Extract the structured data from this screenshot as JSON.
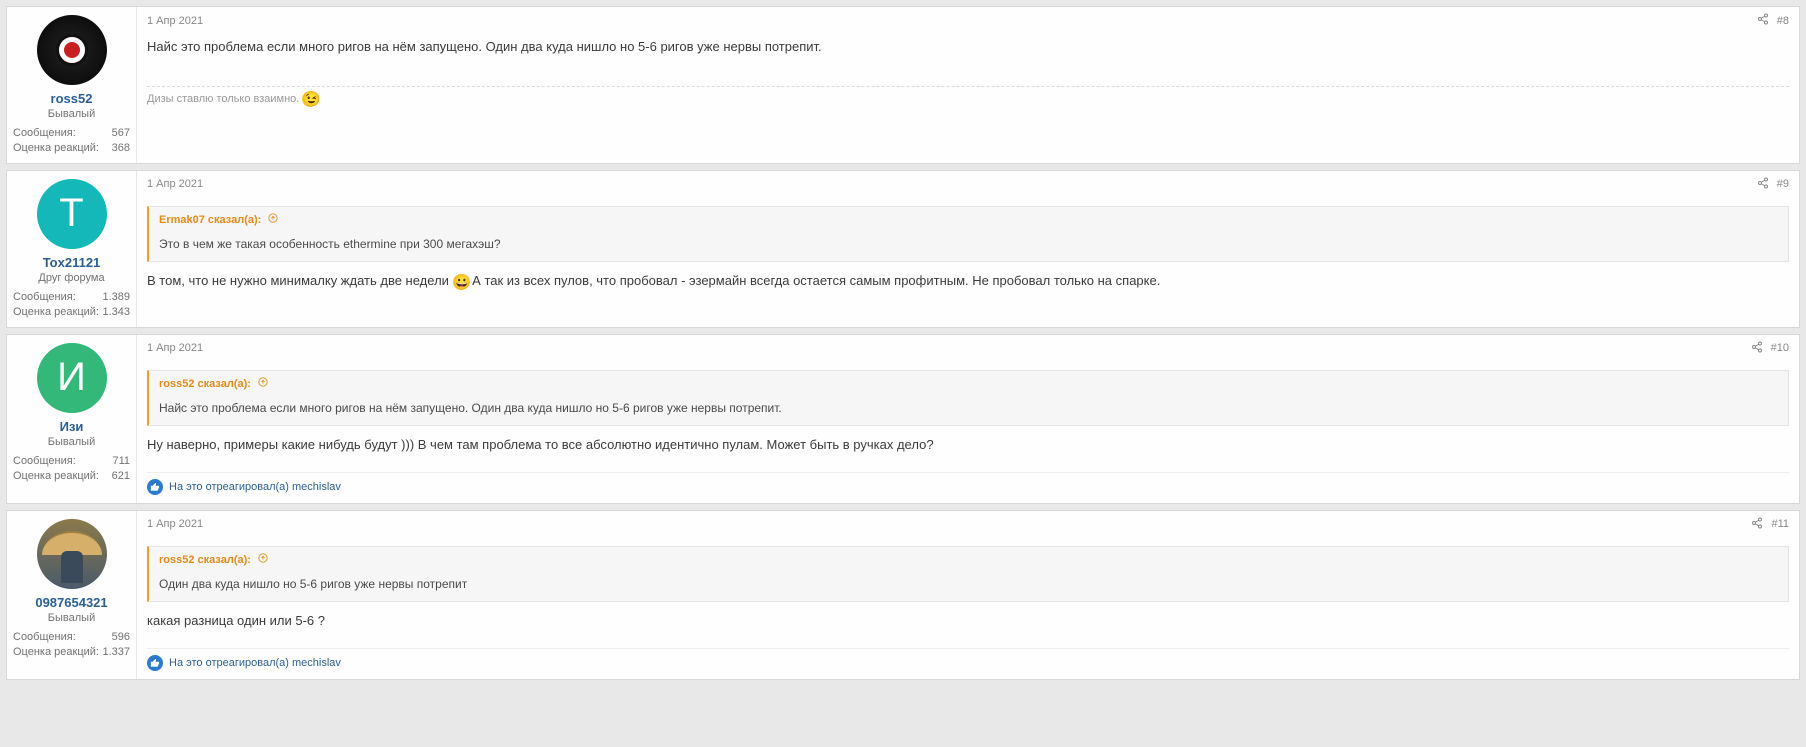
{
  "labels": {
    "messages": "Сообщения:",
    "reactions": "Оценка реакций:"
  },
  "posts": [
    {
      "id": "p0",
      "date": "1 Апр 2021",
      "number": "#8",
      "user": {
        "name": "ross52",
        "title": "Бывалый",
        "avatar_type": "ross",
        "avatar_letter": "",
        "messages": "567",
        "reactions": "368"
      },
      "quote": null,
      "body": "Найс это проблема если много ригов на нём запущено. Один два куда нишло но 5-6 ригов уже нервы потрепит.",
      "body2": null,
      "emoji_in_body": null,
      "signature": "Дизы ставлю только взаимно.",
      "signature_emoji": "wink",
      "reaction_line": null
    },
    {
      "id": "p1",
      "date": "1 Апр 2021",
      "number": "#9",
      "user": {
        "name": "Tox21121",
        "title": "Друг форума",
        "avatar_type": "t",
        "avatar_letter": "Т",
        "messages": "1.389",
        "reactions": "1.343"
      },
      "quote": {
        "attr": "Ermak07 сказал(а):",
        "text": "Это в чем же такая особенность ethermine при 300 мегахэш?"
      },
      "body": "В том, что не нужно минималку ждать две недели",
      "emoji_in_body": "grin",
      "body2": "А так из всех пулов, что пробовал - эзермайн всегда остается самым профитным. Не пробовал только на спарке.",
      "signature": null,
      "signature_emoji": null,
      "reaction_line": null
    },
    {
      "id": "p2",
      "date": "1 Апр 2021",
      "number": "#10",
      "user": {
        "name": "Изи",
        "title": "Бывалый",
        "avatar_type": "i",
        "avatar_letter": "И",
        "messages": "711",
        "reactions": "621"
      },
      "quote": {
        "attr": "ross52 сказал(а):",
        "text": "Найс это проблема если много ригов на нём запущено. Один два куда нишло но 5-6 ригов уже нервы потрепит."
      },
      "body": "Ну наверно, примеры какие нибудь будут ))) В чем там проблема то все абсолютно идентично пулам. Может быть в ручках дело?",
      "emoji_in_body": null,
      "body2": null,
      "signature": null,
      "signature_emoji": null,
      "reaction_line": "На это отреагировал(а) mechislav"
    },
    {
      "id": "p3",
      "date": "1 Апр 2021",
      "number": "#11",
      "user": {
        "name": "0987654321",
        "title": "Бывалый",
        "avatar_type": "hat",
        "avatar_letter": "",
        "messages": "596",
        "reactions": "1.337"
      },
      "quote": {
        "attr": "ross52 сказал(а):",
        "text": "Один два куда нишло но 5-6 ригов уже нервы потрепит"
      },
      "body": "какая разница один или 5-6 ?",
      "emoji_in_body": null,
      "body2": null,
      "signature": null,
      "signature_emoji": null,
      "reaction_line": "На это отреагировал(а) mechislav"
    }
  ]
}
